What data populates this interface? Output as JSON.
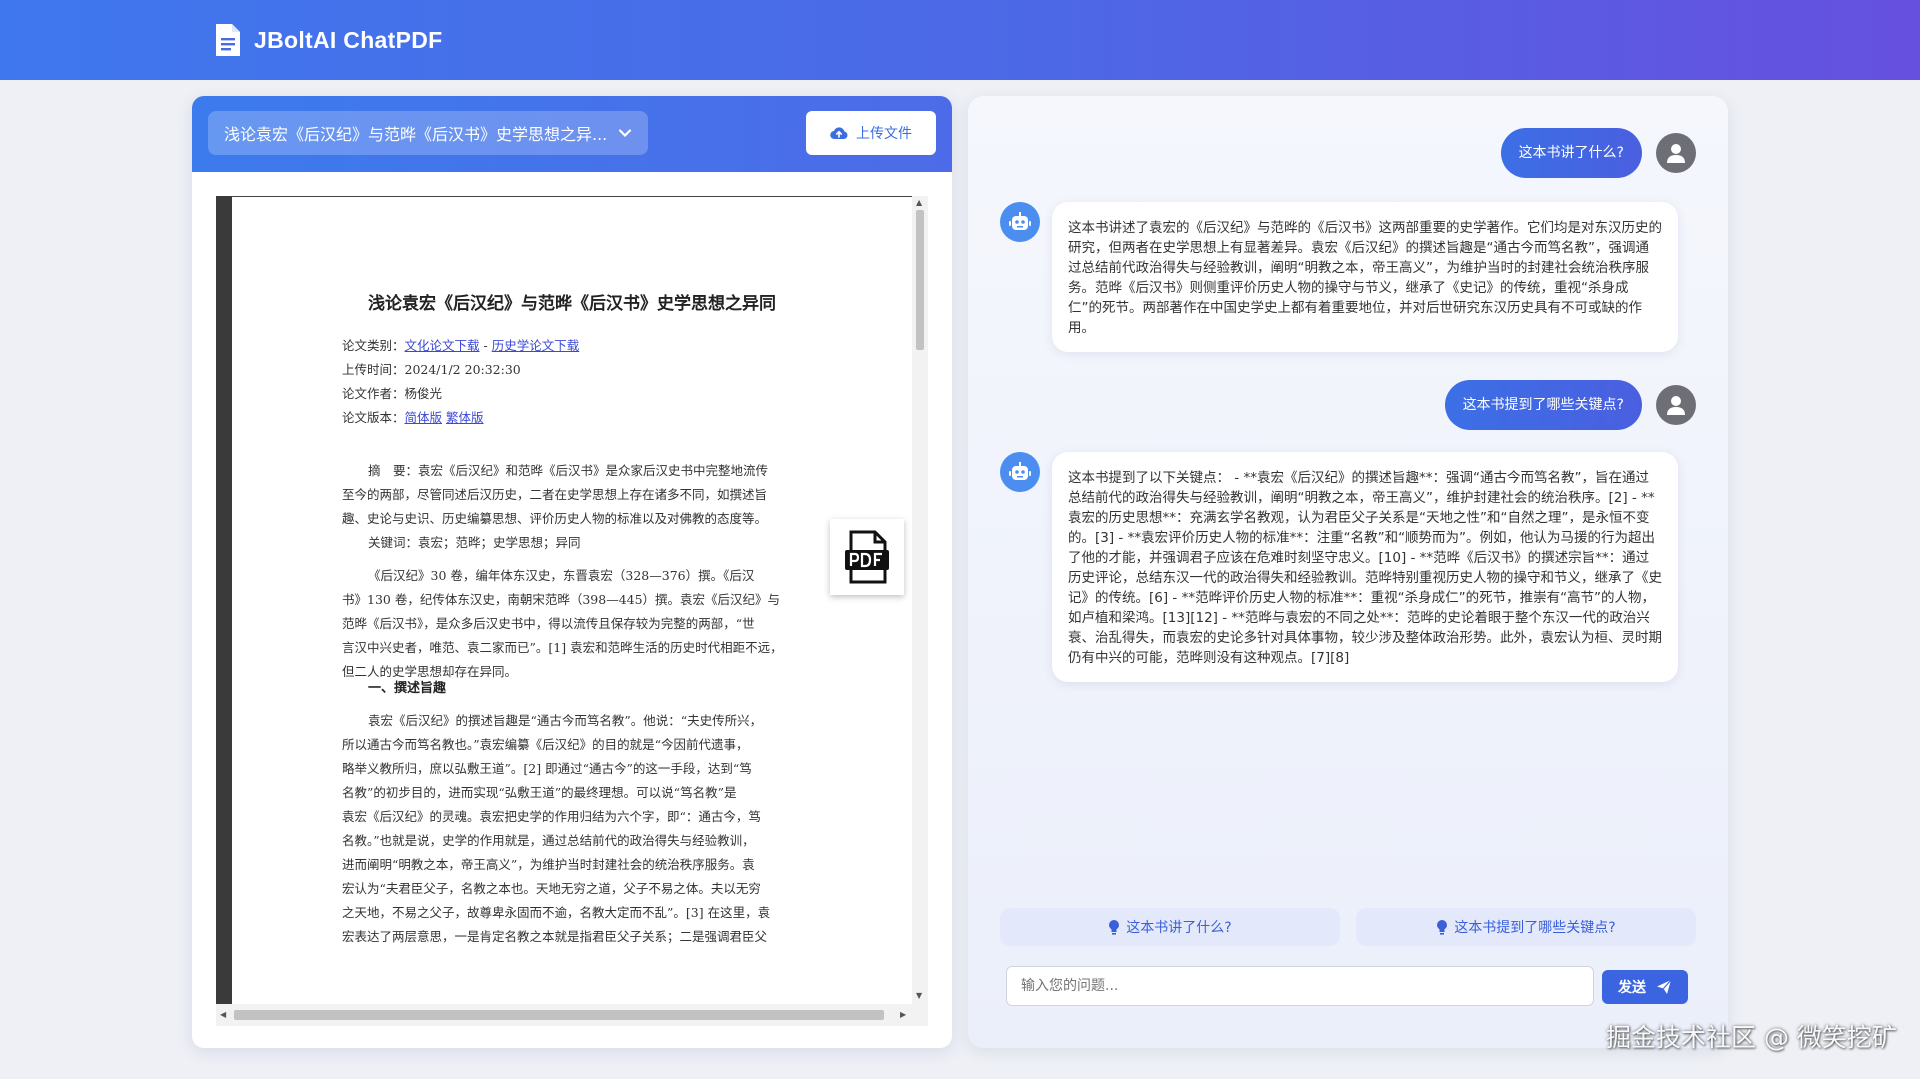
{
  "app": {
    "title": "JBoltAI ChatPDF"
  },
  "left": {
    "selected_doc": "浅论袁宏《后汉纪》与范晔《后汉书》史学思想之异...",
    "upload_label": "上传文件"
  },
  "pdf": {
    "title": "浅论袁宏《后汉纪》与范晔《后汉书》史学思想之异同",
    "category_label": "论文类别：",
    "category_link1": "文化论文下载",
    "category_sep": " - ",
    "category_link2": "历史学论文下载",
    "upload_time": "上传时间：2024/1/2  20:32:30",
    "author": "论文作者：杨俊光",
    "version_label": "论文版本：",
    "version_link1": "简体版",
    "version_link2": "繁体版",
    "abstract": [
      "摘　要：袁宏《后汉纪》和范晔《后汉书》是众家后汉史书中完整地流传",
      "至今的两部，尽管同述后汉历史，二者在史学思想上存在诸多不同，如撰述旨",
      "趣、史论与史识、历史编纂思想、评价历史人物的标准以及对佛教的态度等。"
    ],
    "keywords": "关键词：袁宏；范晔；史学思想；异同",
    "intro": [
      "《后汉纪》30 卷，编年体东汉史，东晋袁宏（328—376）撰。《后汉",
      "书》130 卷，纪传体东汉史，南朝宋范晔（398—445）撰。袁宏《后汉纪》与",
      "范晔《后汉书》，是众多后汉史书中，得以流传且保存较为完整的两部，“世",
      "言汉中兴史者，唯范、袁二家而已”。[1] 袁宏和范晔生活的历史时代相距不远，",
      "但二人的史学思想却存在异同。"
    ],
    "section1": "一、撰述旨趣",
    "body": [
      "袁宏《后汉纪》的撰述旨趣是“通古今而笃名教”。他说：“夫史传所兴，",
      "所以通古今而笃名教也。”袁宏编纂《后汉纪》的目的就是“今因前代遗事，",
      "略举义教所归，庶以弘敷王道”。[2] 即通过“通古今”的这一手段，达到“笃",
      "名教”的初步目的，进而实现“弘敷王道”的最终理想。可以说“笃名教”是",
      "袁宏《后汉纪》的灵魂。袁宏把史学的作用归结为六个字，即“：通古今，笃",
      "名教。”也就是说，史学的作用就是，通过总结前代的政治得失与经验教训，",
      "进而阐明“明教之本，帝王高义”，为维护当时封建社会的统治秩序服务。袁",
      "宏认为“夫君臣父子，名教之本也。天地无穷之道，父子不易之体。夫以无穷",
      "之天地，不易之父子，故尊卑永固而不逾，名教大定而不乱”。[3] 在这里，袁",
      "宏表达了两层意思，一是肯定名教之本就是指君臣父子关系；二是强调君臣父"
    ]
  },
  "chat": {
    "messages": [
      {
        "role": "user",
        "text": "这本书讲了什么?"
      },
      {
        "role": "bot",
        "text": "这本书讲述了袁宏的《后汉纪》与范晔的《后汉书》这两部重要的史学著作。它们均是对东汉历史的研究，但两者在史学思想上有显著差异。袁宏《后汉纪》的撰述旨趣是“通古今而笃名教”，强调通过总结前代政治得失与经验教训，阐明“明教之本，帝王高义”，为维护当时的封建社会统治秩序服务。范晔《后汉书》则侧重评价历史人物的操守与节义，继承了《史记》的传统，重视“杀身成仁”的死节。两部著作在中国史学史上都有着重要地位，并对后世研究东汉历史具有不可或缺的作用。"
      },
      {
        "role": "user",
        "text": "这本书提到了哪些关键点?"
      },
      {
        "role": "bot",
        "text": "这本书提到了以下关键点： - **袁宏《后汉纪》的撰述旨趣**：强调“通古今而笃名教”，旨在通过总结前代的政治得失与经验教训，阐明“明教之本，帝王高义”，维护封建社会的统治秩序。[2] - **袁宏的历史思想**：充满玄学名教观，认为君臣父子关系是“天地之性”和“自然之理”，是永恒不变的。[3] - **袁宏评价历史人物的标准**：注重“名教”和“顺势而为”。例如，他认为马援的行为超出了他的才能，并强调君子应该在危难时刻坚守忠义。[10] - **范晔《后汉书》的撰述宗旨**：通过历史评论，总结东汉一代的政治得失和经验教训。范晔特别重视历史人物的操守和节义，继承了《史记》的传统。[6] - **范晔评价历史人物的标准**：重视“杀身成仁”的死节，推崇有“高节”的人物，如卢植和梁鸿。[13][12] - **范晔与袁宏的不同之处**：范晔的史论着眼于整个东汉一代的政治兴衰、治乱得失，而袁宏的史论多针对具体事物，较少涉及整体政治形势。此外，袁宏认为桓、灵时期仍有中兴的可能，范晔则没有这种观点。[7][8]"
      }
    ],
    "suggestions": [
      "这本书讲了什么?",
      "这本书提到了哪些关键点?"
    ],
    "input_placeholder": "输入您的问题...",
    "send_label": "发送"
  },
  "watermark": "掘金技术社区 @ 微笑挖矿"
}
